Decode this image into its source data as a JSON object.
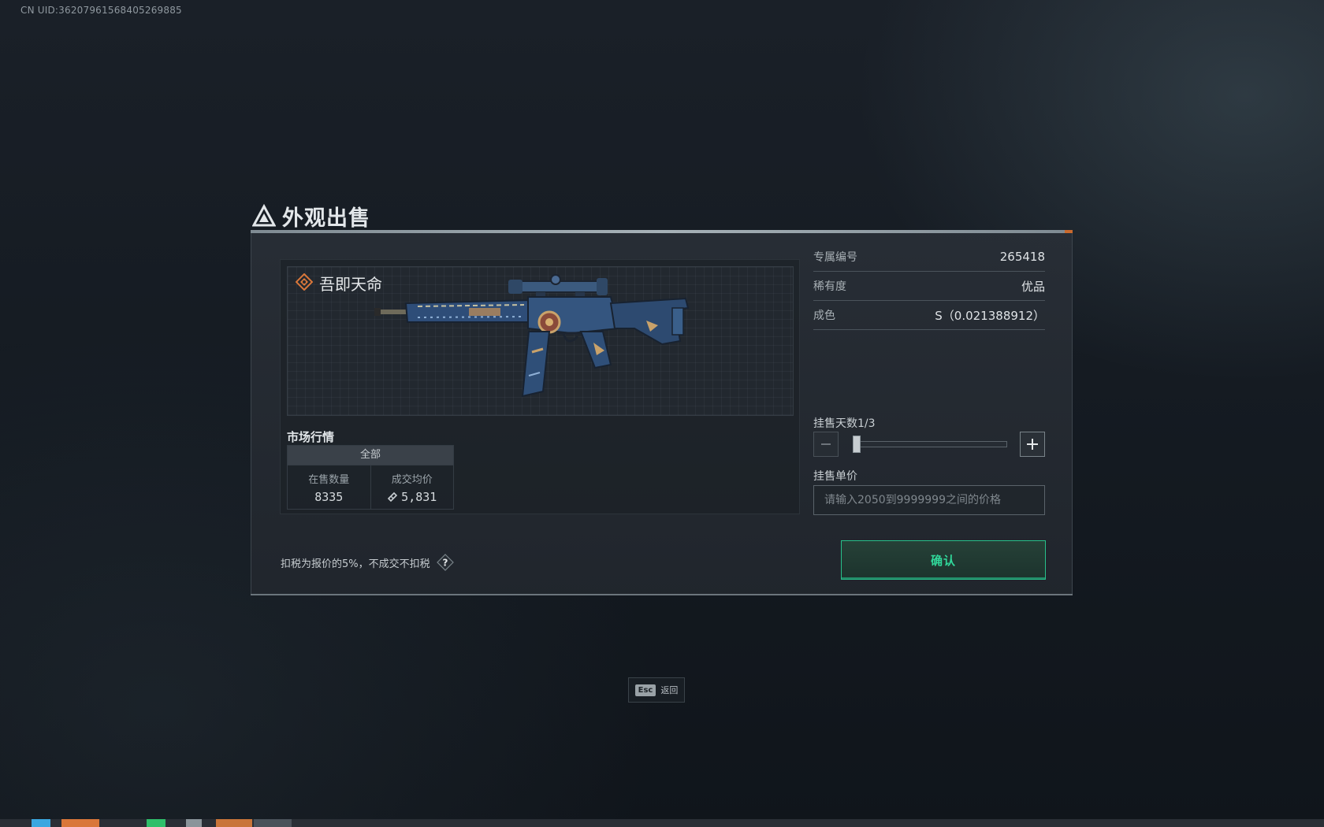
{
  "uid_text": "CN UID:362079615684052698​85",
  "dialog": {
    "title": "外观出售",
    "title_icon": "triangle-logo-icon"
  },
  "item": {
    "name": "吾即天命",
    "rarity_icon": "diamond-rarity-icon",
    "rarity_color": "#d9773a"
  },
  "market": {
    "title": "市场行情",
    "tab_all": "全部",
    "listing_count_label": "在售数量",
    "listing_count_value": "8335",
    "avg_price_label": "成交均价",
    "avg_price_value": "5,831",
    "currency_icon": "ticket-icon"
  },
  "details": {
    "serial_label": "专属编号",
    "serial_value": "265418",
    "rarity_label": "稀有度",
    "rarity_value": "优品",
    "wear_label": "成色",
    "wear_value": "S（0.021388912）"
  },
  "listing": {
    "days_label": "挂售天数1/3",
    "days_current": 1,
    "days_max": 3,
    "price_label": "挂售单价",
    "price_placeholder": "请输入2050到9999999之间的价格",
    "price_value": ""
  },
  "footer": {
    "tax_note": "扣税为报价的5%，不成交不扣税",
    "help_label": "?",
    "confirm_label": "确认"
  },
  "esc_hint": {
    "key": "Esc",
    "label": "返回"
  },
  "colors": {
    "accent_green": "#27c08a",
    "accent_orange": "#d9773a"
  }
}
